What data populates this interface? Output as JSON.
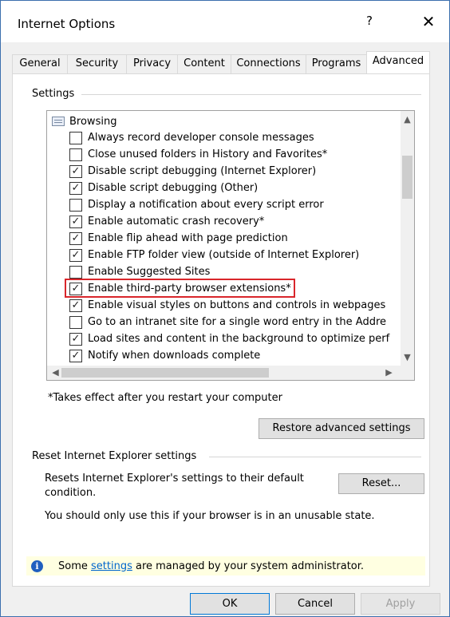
{
  "window": {
    "title": "Internet Options",
    "help": "?",
    "close": "✕"
  },
  "tabs": [
    {
      "label": "General"
    },
    {
      "label": "Security"
    },
    {
      "label": "Privacy"
    },
    {
      "label": "Content"
    },
    {
      "label": "Connections"
    },
    {
      "label": "Programs"
    },
    {
      "label": "Advanced",
      "active": true
    }
  ],
  "settings": {
    "group_label": "Settings",
    "category": "Browsing",
    "items": [
      {
        "label": "Always record developer console messages",
        "checked": false
      },
      {
        "label": "Close unused folders in History and Favorites*",
        "checked": false
      },
      {
        "label": "Disable script debugging (Internet Explorer)",
        "checked": true
      },
      {
        "label": "Disable script debugging (Other)",
        "checked": true
      },
      {
        "label": "Display a notification about every script error",
        "checked": false
      },
      {
        "label": "Enable automatic crash recovery*",
        "checked": true
      },
      {
        "label": "Enable flip ahead with page prediction",
        "checked": true
      },
      {
        "label": "Enable FTP folder view (outside of Internet Explorer)",
        "checked": true
      },
      {
        "label": "Enable Suggested Sites",
        "checked": false
      },
      {
        "label": "Enable third-party browser extensions*",
        "checked": true
      },
      {
        "label": "Enable visual styles on buttons and controls in webpages",
        "checked": true
      },
      {
        "label": "Go to an intranet site for a single word entry in the Addre",
        "checked": false
      },
      {
        "label": "Load sites and content in the background to optimize perf",
        "checked": true
      },
      {
        "label": "Notify when downloads complete",
        "checked": true
      }
    ],
    "restart_note": "*Takes effect after you restart your computer",
    "restore_button": "Restore advanced settings"
  },
  "reset": {
    "group_label": "Reset Internet Explorer settings",
    "description": "Resets Internet Explorer's settings to their default condition.",
    "button": "Reset...",
    "warning": "You should only use this if your browser is in an unusable state."
  },
  "infobar": {
    "prefix": "Some ",
    "link": "settings",
    "suffix": " are managed by your system administrator."
  },
  "buttons": {
    "ok": "OK",
    "cancel": "Cancel",
    "apply": "Apply"
  },
  "check_glyph": "✓",
  "colors": {
    "highlight": "#d9262b",
    "link": "#0066cc",
    "info_bg": "#ffffe1"
  }
}
